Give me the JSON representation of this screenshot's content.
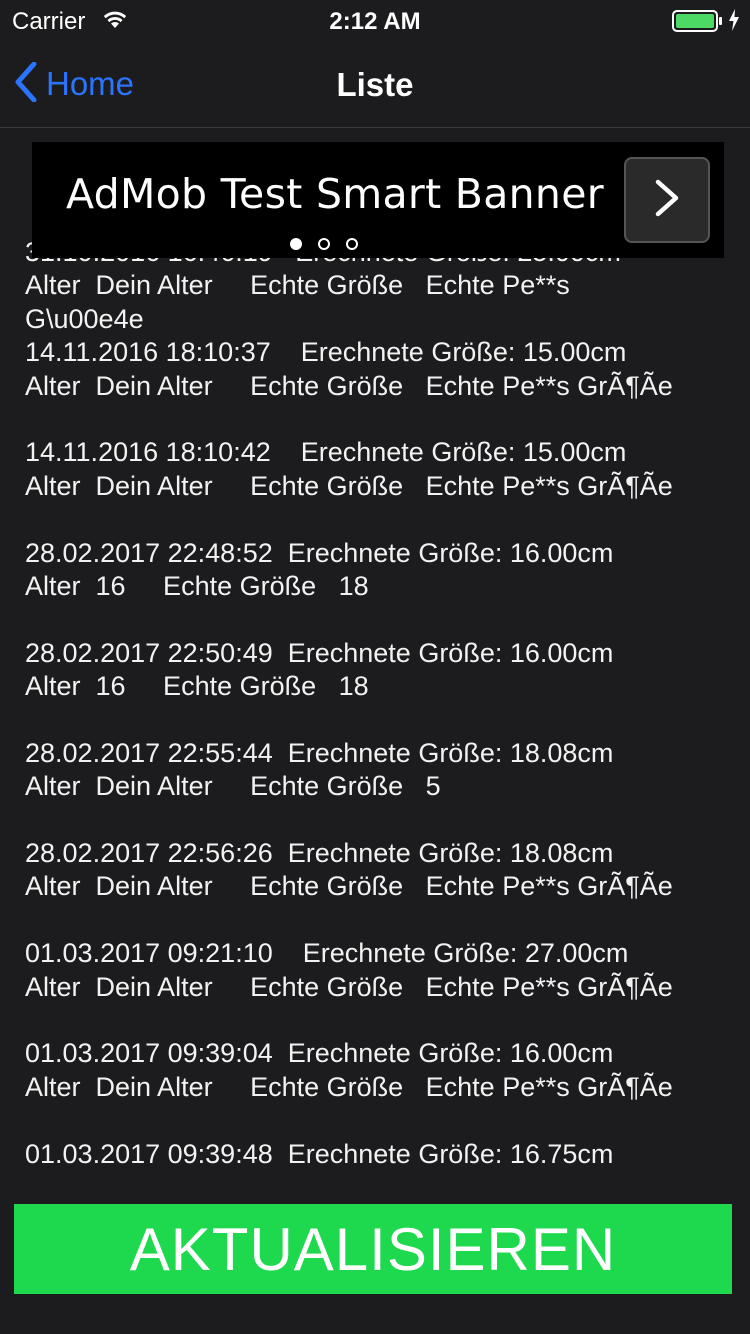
{
  "status_bar": {
    "carrier": "Carrier",
    "time": "2:12 AM",
    "battery_color": "#4cd964"
  },
  "nav": {
    "back_label": "Home",
    "title": "Liste",
    "tint_color": "#2a74ff"
  },
  "ad": {
    "text": "AdMob Test Smart Banner",
    "page_count": 3,
    "active_page": 0
  },
  "entries": [
    {
      "line1": "31.10.2016 16:46:19   Erechnete Größe: 25.00cm",
      "line2": "Alter  Dein Alter     Echte Größe   Echte Pe**s",
      "line3": "G\\u00e4e"
    },
    {
      "line1": "14.11.2016 18:10:37    Erechnete Größe: 15.00cm",
      "line2": "Alter  Dein Alter     Echte Größe   Echte Pe**s GrÃ¶Ãe"
    },
    {
      "line1": "14.11.2016 18:10:42    Erechnete Größe: 15.00cm",
      "line2": "Alter  Dein Alter     Echte Größe   Echte Pe**s GrÃ¶Ãe"
    },
    {
      "line1": "28.02.2017 22:48:52  Erechnete Größe: 16.00cm",
      "line2": "Alter  16     Echte Größe   18"
    },
    {
      "line1": "28.02.2017 22:50:49  Erechnete Größe: 16.00cm",
      "line2": "Alter  16     Echte Größe   18"
    },
    {
      "line1": "28.02.2017 22:55:44  Erechnete Größe: 18.08cm",
      "line2": "Alter  Dein Alter     Echte Größe   5"
    },
    {
      "line1": "28.02.2017 22:56:26  Erechnete Größe: 18.08cm",
      "line2": "Alter  Dein Alter     Echte Größe   Echte Pe**s GrÃ¶Ãe"
    },
    {
      "line1": "01.03.2017 09:21:10    Erechnete Größe: 27.00cm",
      "line2": "Alter  Dein Alter     Echte Größe   Echte Pe**s GrÃ¶Ãe"
    },
    {
      "line1": "01.03.2017 09:39:04  Erechnete Größe: 16.00cm",
      "line2": "Alter  Dein Alter     Echte Größe   Echte Pe**s GrÃ¶Ãe"
    },
    {
      "line1": "01.03.2017 09:39:48  Erechnete Größe: 16.75cm"
    }
  ],
  "update_button": {
    "label": "AKTUALISIEREN",
    "color": "#1ed84e"
  }
}
